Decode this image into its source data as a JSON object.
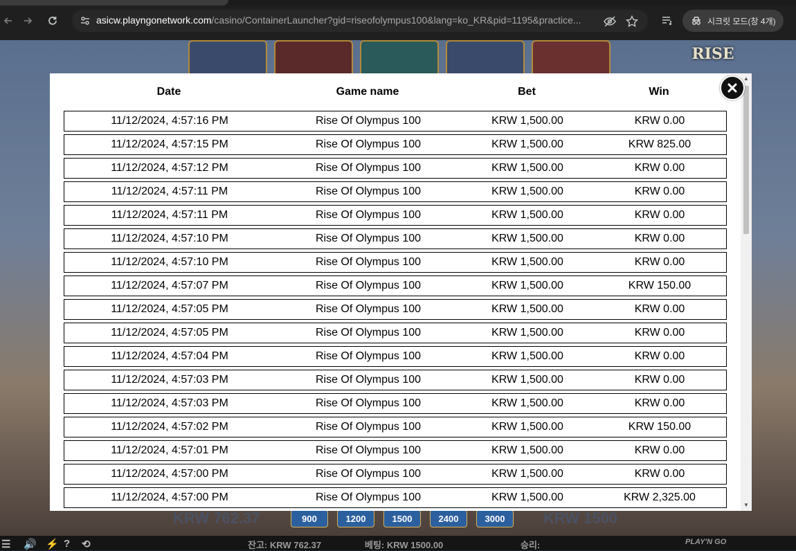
{
  "browser": {
    "url_host": "asicw.playngonetwork.com",
    "url_path": "/casino/ContainerLauncher?gid=riseofolympus100&lang=ko_KR&pid=1195&practice...",
    "incognito_label": "시크릿 모드(창 4개)"
  },
  "game": {
    "logo_text": "RISE",
    "balance_stake_left": "KRW 762.37",
    "bet_chips": [
      "900",
      "1200",
      "1500",
      "2400",
      "3000"
    ],
    "stake_right": "KRW 1500",
    "status": {
      "balance": "잔고: KRW 762.37",
      "bet": "베팅: KRW 1500.00",
      "win": "승리:",
      "brand": "PLAY'N GO"
    }
  },
  "history": {
    "headers": {
      "date": "Date",
      "game": "Game name",
      "bet": "Bet",
      "win": "Win"
    },
    "rows": [
      {
        "date": "11/12/2024, 4:57:16 PM",
        "game": "Rise Of Olympus 100",
        "bet": "KRW 1,500.00",
        "win": "KRW 0.00"
      },
      {
        "date": "11/12/2024, 4:57:15 PM",
        "game": "Rise Of Olympus 100",
        "bet": "KRW 1,500.00",
        "win": "KRW 825.00"
      },
      {
        "date": "11/12/2024, 4:57:12 PM",
        "game": "Rise Of Olympus 100",
        "bet": "KRW 1,500.00",
        "win": "KRW 0.00"
      },
      {
        "date": "11/12/2024, 4:57:11 PM",
        "game": "Rise Of Olympus 100",
        "bet": "KRW 1,500.00",
        "win": "KRW 0.00"
      },
      {
        "date": "11/12/2024, 4:57:11 PM",
        "game": "Rise Of Olympus 100",
        "bet": "KRW 1,500.00",
        "win": "KRW 0.00"
      },
      {
        "date": "11/12/2024, 4:57:10 PM",
        "game": "Rise Of Olympus 100",
        "bet": "KRW 1,500.00",
        "win": "KRW 0.00"
      },
      {
        "date": "11/12/2024, 4:57:10 PM",
        "game": "Rise Of Olympus 100",
        "bet": "KRW 1,500.00",
        "win": "KRW 0.00"
      },
      {
        "date": "11/12/2024, 4:57:07 PM",
        "game": "Rise Of Olympus 100",
        "bet": "KRW 1,500.00",
        "win": "KRW 150.00"
      },
      {
        "date": "11/12/2024, 4:57:05 PM",
        "game": "Rise Of Olympus 100",
        "bet": "KRW 1,500.00",
        "win": "KRW 0.00"
      },
      {
        "date": "11/12/2024, 4:57:05 PM",
        "game": "Rise Of Olympus 100",
        "bet": "KRW 1,500.00",
        "win": "KRW 0.00"
      },
      {
        "date": "11/12/2024, 4:57:04 PM",
        "game": "Rise Of Olympus 100",
        "bet": "KRW 1,500.00",
        "win": "KRW 0.00"
      },
      {
        "date": "11/12/2024, 4:57:03 PM",
        "game": "Rise Of Olympus 100",
        "bet": "KRW 1,500.00",
        "win": "KRW 0.00"
      },
      {
        "date": "11/12/2024, 4:57:03 PM",
        "game": "Rise Of Olympus 100",
        "bet": "KRW 1,500.00",
        "win": "KRW 0.00"
      },
      {
        "date": "11/12/2024, 4:57:02 PM",
        "game": "Rise Of Olympus 100",
        "bet": "KRW 1,500.00",
        "win": "KRW 150.00"
      },
      {
        "date": "11/12/2024, 4:57:01 PM",
        "game": "Rise Of Olympus 100",
        "bet": "KRW 1,500.00",
        "win": "KRW 0.00"
      },
      {
        "date": "11/12/2024, 4:57:00 PM",
        "game": "Rise Of Olympus 100",
        "bet": "KRW 1,500.00",
        "win": "KRW 0.00"
      },
      {
        "date": "11/12/2024, 4:57:00 PM",
        "game": "Rise Of Olympus 100",
        "bet": "KRW 1,500.00",
        "win": "KRW 2,325.00"
      }
    ]
  }
}
